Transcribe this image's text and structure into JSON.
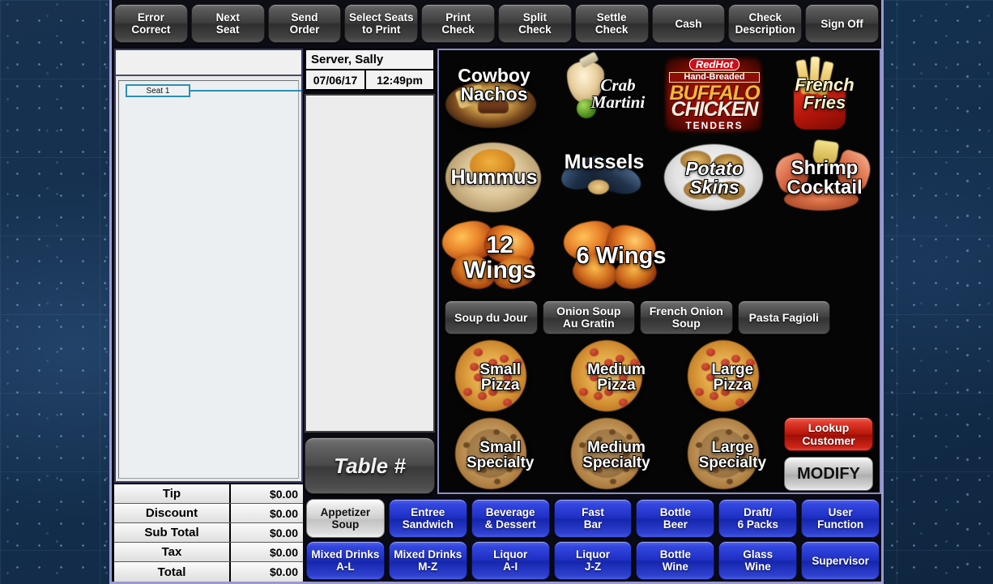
{
  "toolbar": {
    "buttons": [
      {
        "label": "Error\nCorrect",
        "name": "error-correct"
      },
      {
        "label": "Next\nSeat",
        "name": "next-seat"
      },
      {
        "label": "Send\nOrder",
        "name": "send-order"
      },
      {
        "label": "Select Seats\nto Print",
        "name": "select-seats-to-print"
      },
      {
        "label": "Print\nCheck",
        "name": "print-check"
      },
      {
        "label": "Split\nCheck",
        "name": "split-check"
      },
      {
        "label": "Settle\nCheck",
        "name": "settle-check"
      },
      {
        "label": "Cash",
        "name": "cash"
      },
      {
        "label": "Check\nDescription",
        "name": "check-description"
      },
      {
        "label": "Sign Off",
        "name": "sign-off"
      }
    ]
  },
  "order_panel": {
    "seat_label": "Seat 1"
  },
  "check": {
    "server": "Server, Sally",
    "date": "07/06/17",
    "time": "12:49pm",
    "table_button": "Table #"
  },
  "totals": [
    {
      "label": "Tip",
      "value": "$0.00"
    },
    {
      "label": "Discount",
      "value": "$0.00"
    },
    {
      "label": "Sub Total",
      "value": "$0.00"
    },
    {
      "label": "Tax",
      "value": "$0.00"
    },
    {
      "label": "Total",
      "value": "$0.00"
    }
  ],
  "menu": {
    "row1": [
      {
        "label": "Cowboy\nNachos",
        "name": "cowboy-nachos"
      },
      {
        "label": "Crab\nMartini",
        "name": "crab-martini"
      },
      {
        "label": "",
        "name": "buffalo-chicken-tenders"
      },
      {
        "label": "French\nFries",
        "name": "french-fries"
      }
    ],
    "buffalo_logo": {
      "brand": "RedHot",
      "line1": "Hand-Breaded",
      "line2": "BUFFALO",
      "line3": "CHICKEN",
      "line4": "TENDERS"
    },
    "row2": [
      {
        "label": "Hummus",
        "name": "hummus"
      },
      {
        "label": "Mussels",
        "name": "mussels"
      },
      {
        "label": "Potato\nSkins",
        "name": "potato-skins"
      },
      {
        "label": "Shrimp\nCocktail",
        "name": "shrimp-cocktail"
      }
    ],
    "row3": [
      {
        "label": "12\nWings",
        "name": "12-wings"
      },
      {
        "label": "6 Wings",
        "name": "6-wings"
      }
    ],
    "soups": [
      {
        "label": "Soup du Jour",
        "name": "soup-du-jour"
      },
      {
        "label": "Onion Soup\nAu Gratin",
        "name": "onion-soup-au-gratin"
      },
      {
        "label": "French Onion\nSoup",
        "name": "french-onion-soup"
      },
      {
        "label": "Pasta Fagioli",
        "name": "pasta-fagioli"
      }
    ],
    "pizzas": [
      {
        "label": "Small\nPizza",
        "name": "small-pizza"
      },
      {
        "label": "Medium\nPizza",
        "name": "medium-pizza"
      },
      {
        "label": "Large\nPizza",
        "name": "large-pizza"
      }
    ],
    "specialties": [
      {
        "label": "Small\nSpecialty",
        "name": "small-specialty"
      },
      {
        "label": "Medium\nSpecialty",
        "name": "medium-specialty"
      },
      {
        "label": "Large\nSpecialty",
        "name": "large-specialty"
      }
    ],
    "lookup_customer": "Lookup\nCustomer",
    "modify": "MODIFY"
  },
  "categories": {
    "row1": [
      {
        "label": "Appetizer\nSoup",
        "name": "appetizer-soup",
        "active": true
      },
      {
        "label": "Entree\nSandwich",
        "name": "entree-sandwich",
        "active": false
      },
      {
        "label": "Beverage\n& Dessert",
        "name": "beverage-dessert",
        "active": false
      },
      {
        "label": "Fast\nBar",
        "name": "fast-bar",
        "active": false
      },
      {
        "label": "Bottle\nBeer",
        "name": "bottle-beer",
        "active": false
      },
      {
        "label": "Draft/\n6 Packs",
        "name": "draft-6-packs",
        "active": false
      },
      {
        "label": "User\nFunction",
        "name": "user-function",
        "active": false
      }
    ],
    "row2": [
      {
        "label": "Mixed Drinks\nA-L",
        "name": "mixed-drinks-a-l",
        "active": false
      },
      {
        "label": "Mixed Drinks\nM-Z",
        "name": "mixed-drinks-m-z",
        "active": false
      },
      {
        "label": "Liquor\nA-I",
        "name": "liquor-a-i",
        "active": false
      },
      {
        "label": "Liquor\nJ-Z",
        "name": "liquor-j-z",
        "active": false
      },
      {
        "label": "Bottle\nWine",
        "name": "bottle-wine",
        "active": false
      },
      {
        "label": "Glass\nWine",
        "name": "glass-wine",
        "active": false
      },
      {
        "label": "Supervisor",
        "name": "supervisor",
        "active": false
      }
    ]
  },
  "colors": {
    "accent_blue": "#1f2fc4",
    "lookup_red": "#b8150a",
    "desktop_blue": "#14304f",
    "frame_lavender": "#9a9ad0",
    "seat_chip_border": "#2b8fb5"
  }
}
